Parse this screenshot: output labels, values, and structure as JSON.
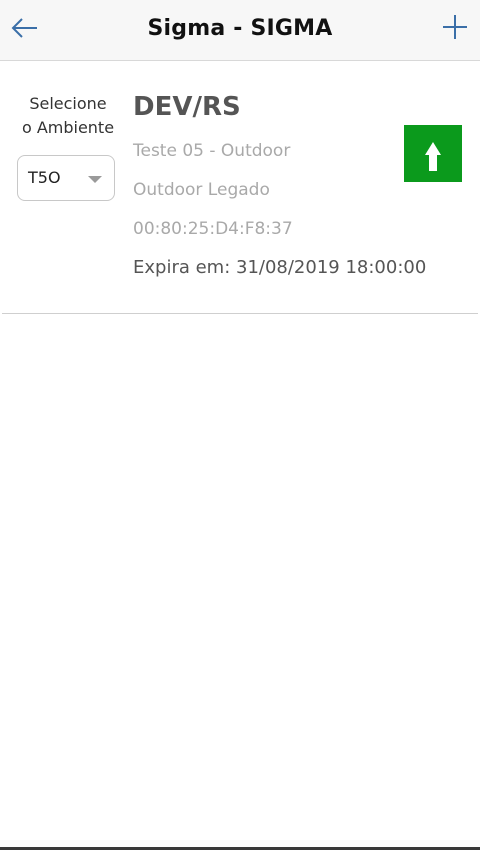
{
  "header": {
    "title": "Sigma - SIGMA",
    "back_icon": "arrow-left-icon",
    "add_icon": "plus-icon"
  },
  "environment": {
    "label_line1": "Selecione",
    "label_line2": "o Ambiente",
    "selected": "T5O"
  },
  "device": {
    "name": "DEV/RS",
    "description": "Teste 05 - Outdoor",
    "type": "Outdoor Legado",
    "mac": "00:80:25:D4:F8:37",
    "expiry": "Expira em: 31/08/2019 18:00:00",
    "action_icon": "arrow-up-icon",
    "action_color": "#0b9a1c"
  }
}
